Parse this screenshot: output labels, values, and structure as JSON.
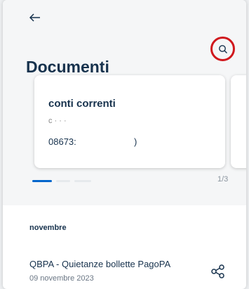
{
  "header": {
    "back_icon": "arrow-left-icon",
    "title": "Documenti",
    "search_icon": "search-icon"
  },
  "carousel": {
    "card": {
      "title": "conti correnti",
      "subtitle": "c · · ·",
      "number_prefix": "08673:",
      "number_suffix": ")"
    },
    "pager": "1/3",
    "active_index": 0,
    "total": 3
  },
  "documents": {
    "section_label": "novembre",
    "items": [
      {
        "title": "QBPA - Quietanze bollette PagoPA",
        "date": "09 novembre 2023",
        "action_icon": "share-icon"
      }
    ]
  },
  "colors": {
    "primary": "#17324d",
    "accent": "#0066cc",
    "highlight_ring": "#d0181d"
  }
}
